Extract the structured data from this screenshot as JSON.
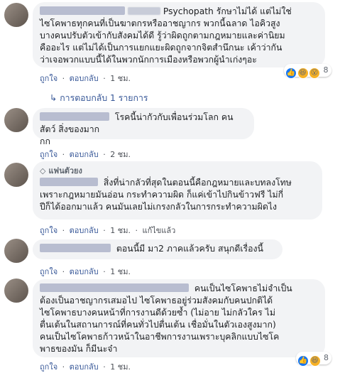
{
  "comments": [
    {
      "text_lines": [
        "Psychopath รักษาไม่ได้ แต่ไม่ใช่",
        "ไซโคพาธทุกคนที่เป็นฆาตกรหรืออาชญากร พวกนี้ฉลาด ไอคิวสูง",
        "บางคนปรับตัวเข้ากับสังคมได้ดี รู้ว่าผิดถูกตามกฎหมายและค่านิยม",
        "คืออะไร แต่ไม่ได้เป็นการแยกแยะผิดถูกจากจิตสำนึกนะ เค้าว่ากัน",
        "ว่าเจอพวกแบบนี้ได้ในพวกนักการเมืองหรือพวกผู้นำเก่งๆอะ"
      ],
      "like": "ถูกใจ",
      "reply": "ตอบกลับ",
      "time": "1 ชม.",
      "reactions_count": "8",
      "reaction_icons": [
        "like-icon",
        "haha-icon",
        "wow-icon"
      ]
    },
    {
      "text_lines": [
        "โรคนี้น่ากัวกับเพื่อนร่วมโลก คน สัตว์ สิ่งของมาก",
        "กก"
      ],
      "like": "ถูกใจ",
      "reply": "ตอบกลับ",
      "time": "2 ชม."
    },
    {
      "fan_label": "แฟนตัวยง",
      "text_lines": [
        "สิ่งที่น่ากลัวที่สุดในตอนนี้คือกฎหมายและบทลงโทษ",
        "เพราะกฎหมายมันอ่อน กระทำความผิด ก็แค่เข้าไปกินข้าวฟรี ไม่กี่",
        "ปีก็ได้ออกมาแล้ว คนมันเลยไม่เกรงกลัวในการกระทำความผิดไง"
      ],
      "like": "ถูกใจ",
      "reply": "ตอบกลับ",
      "time": "1 ชม.",
      "edited": "แก้ไขแล้ว"
    },
    {
      "text_lines": [
        "ตอนนี้มี มา2 ภาคแล้วครับ สนุกดีเรื่องนี้"
      ],
      "like": "ถูกใจ",
      "reply": "ตอบกลับ",
      "time": "1 ชม."
    },
    {
      "text_lines": [
        "คนเป็นไซโคพาธไม่จำเป็น",
        "ต้องเป็นอาชญากรเสมอไป ไซโคพาธอยู่ร่วมสังคมกับคนปกติได้",
        "ไซโคพาธบางคนหน้าที่การงานดีด้วยซ้ำ (ไม่อาย ไม่กลัวใคร ไม่",
        "ตื่นเต้นในสถานการณ์ที่คนทั่วไปตื่นเต้น เชื่อมั่นในตัวเองสูงมาก)",
        "คนเป็นไซโคพาธก้าวหน้าในอาชีพการงานเพราะบุคลิกแบบไซโค",
        "พาธของมัน ก็มีนะจ๋า"
      ],
      "like": "ถูกใจ",
      "reply": "ตอบกลับ",
      "time": "1 ชม.",
      "reactions_count": "8",
      "reaction_icons": [
        "like-icon",
        "haha-icon"
      ]
    }
  ],
  "replies_link": "การตอบกลับ 1 รายการ",
  "colors": {
    "link": "#385898",
    "bubble": "#f2f3f5",
    "text": "#1c1e21",
    "meta": "#4b4f56"
  }
}
